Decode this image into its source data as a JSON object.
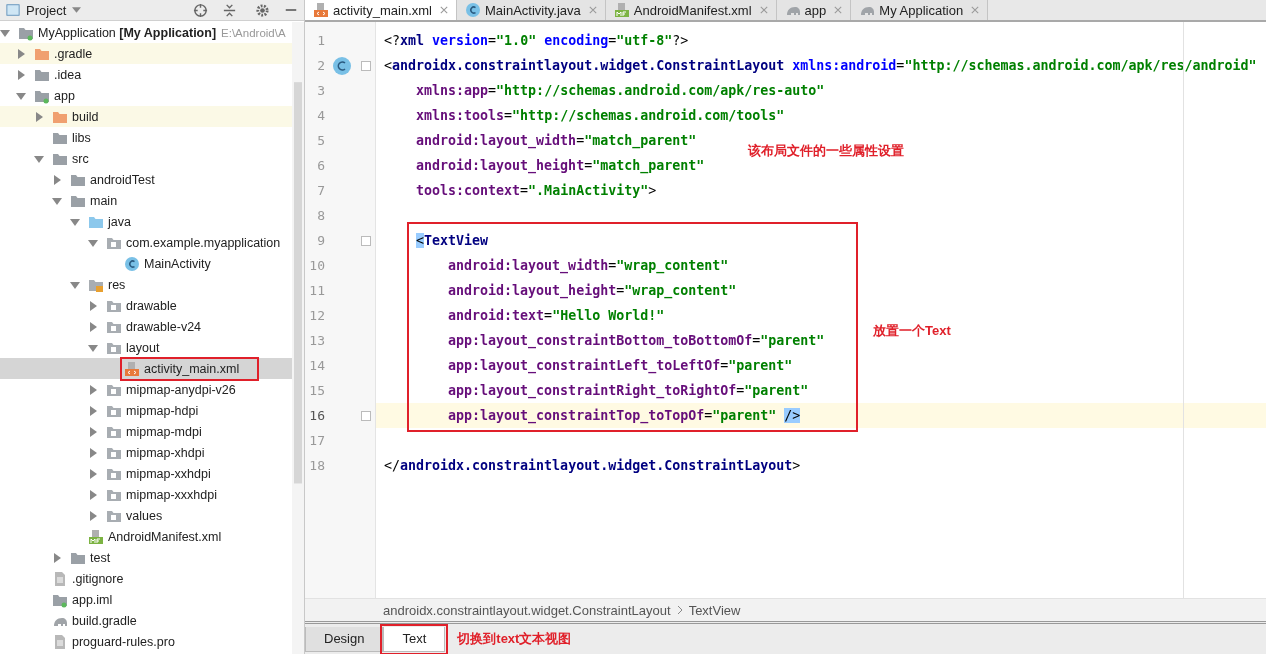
{
  "project_panel": {
    "title": "Project",
    "tree": [
      {
        "label": "MyApplication **[My Application]**",
        "path": "E:\\Android\\A",
        "kind": "module",
        "expanded": true,
        "selected": false,
        "highlighted": false,
        "boxed": false,
        "children": [
          {
            "label": ".gradle",
            "kind": "folder_orange",
            "expanded": false,
            "selected": false,
            "highlighted": true,
            "boxed": false
          },
          {
            "label": ".idea",
            "kind": "folder",
            "expanded": false,
            "selected": false,
            "highlighted": false,
            "boxed": false
          },
          {
            "label": "app",
            "kind": "module",
            "expanded": true,
            "selected": false,
            "highlighted": false,
            "boxed": false,
            "children": [
              {
                "label": "build",
                "kind": "folder_orange",
                "expanded": false,
                "selected": false,
                "highlighted": true,
                "boxed": false
              },
              {
                "label": "libs",
                "kind": "folder",
                "selected": false,
                "highlighted": false,
                "boxed": false
              },
              {
                "label": "src",
                "kind": "folder",
                "expanded": true,
                "selected": false,
                "highlighted": false,
                "boxed": false,
                "children": [
                  {
                    "label": "androidTest",
                    "kind": "folder",
                    "expanded": false,
                    "selected": false,
                    "highlighted": false,
                    "boxed": false
                  },
                  {
                    "label": "main",
                    "kind": "folder",
                    "expanded": true,
                    "selected": false,
                    "highlighted": false,
                    "boxed": false,
                    "children": [
                      {
                        "label": "java",
                        "kind": "folder_blue",
                        "expanded": true,
                        "selected": false,
                        "highlighted": false,
                        "boxed": false,
                        "children": [
                          {
                            "label": "com.example.myapplication",
                            "kind": "package",
                            "expanded": true,
                            "selected": false,
                            "highlighted": false,
                            "boxed": false,
                            "children": [
                              {
                                "label": "MainActivity",
                                "kind": "class",
                                "selected": false,
                                "highlighted": false,
                                "boxed": false
                              }
                            ]
                          }
                        ]
                      },
                      {
                        "label": "res",
                        "kind": "res",
                        "expanded": true,
                        "selected": false,
                        "highlighted": false,
                        "boxed": false,
                        "children": [
                          {
                            "label": "drawable",
                            "kind": "package",
                            "expanded": false,
                            "selected": false,
                            "highlighted": false,
                            "boxed": false
                          },
                          {
                            "label": "drawable-v24",
                            "kind": "package",
                            "expanded": false,
                            "selected": false,
                            "highlighted": false,
                            "boxed": false
                          },
                          {
                            "label": "layout",
                            "kind": "package",
                            "expanded": true,
                            "selected": false,
                            "highlighted": false,
                            "boxed": false,
                            "children": [
                              {
                                "label": "activity_main.xml",
                                "kind": "xml",
                                "selected": true,
                                "highlighted": false,
                                "boxed": true
                              }
                            ]
                          },
                          {
                            "label": "mipmap-anydpi-v26",
                            "kind": "package",
                            "expanded": false,
                            "selected": false,
                            "highlighted": false,
                            "boxed": false
                          },
                          {
                            "label": "mipmap-hdpi",
                            "kind": "package",
                            "expanded": false,
                            "selected": false,
                            "highlighted": false,
                            "boxed": false
                          },
                          {
                            "label": "mipmap-mdpi",
                            "kind": "package",
                            "expanded": false,
                            "selected": false,
                            "highlighted": false,
                            "boxed": false
                          },
                          {
                            "label": "mipmap-xhdpi",
                            "kind": "package",
                            "expanded": false,
                            "selected": false,
                            "highlighted": false,
                            "boxed": false
                          },
                          {
                            "label": "mipmap-xxhdpi",
                            "kind": "package",
                            "expanded": false,
                            "selected": false,
                            "highlighted": false,
                            "boxed": false
                          },
                          {
                            "label": "mipmap-xxxhdpi",
                            "kind": "package",
                            "expanded": false,
                            "selected": false,
                            "highlighted": false,
                            "boxed": false
                          },
                          {
                            "label": "values",
                            "kind": "package",
                            "expanded": false,
                            "selected": false,
                            "highlighted": false,
                            "boxed": false
                          }
                        ]
                      },
                      {
                        "label": "AndroidManifest.xml",
                        "kind": "manifest",
                        "selected": false,
                        "highlighted": false,
                        "boxed": false
                      }
                    ]
                  },
                  {
                    "label": "test",
                    "kind": "folder",
                    "expanded": false,
                    "selected": false,
                    "highlighted": false,
                    "boxed": false
                  }
                ]
              },
              {
                "label": ".gitignore",
                "kind": "file",
                "selected": false,
                "highlighted": false,
                "boxed": false
              },
              {
                "label": "app.iml",
                "kind": "iml",
                "selected": false,
                "highlighted": false,
                "boxed": false
              },
              {
                "label": "build.gradle",
                "kind": "gradle",
                "selected": false,
                "highlighted": false,
                "boxed": false
              },
              {
                "label": "proguard-rules.pro",
                "kind": "file",
                "selected": false,
                "highlighted": false,
                "boxed": false
              }
            ]
          }
        ]
      }
    ]
  },
  "editor_tabs": [
    {
      "label": "activity_main.xml",
      "kind": "xml",
      "selected": true
    },
    {
      "label": "MainActivity.java",
      "kind": "class",
      "selected": false
    },
    {
      "label": "AndroidManifest.xml",
      "kind": "manifest",
      "selected": false
    },
    {
      "label": "app",
      "kind": "gradle",
      "selected": false
    },
    {
      "label": "My Application",
      "kind": "gradle",
      "selected": false
    }
  ],
  "code": [
    {
      "number": "1",
      "kind": "plain",
      "current": false,
      "boxed": false,
      "segments": [
        {
          "kind": "p",
          "text": "<?"
        },
        {
          "kind": "tag",
          "text": "xml"
        },
        {
          "kind": "attr",
          "text": " version"
        },
        {
          "kind": "p",
          "text": "="
        },
        {
          "kind": "value",
          "text": "\"1.0\""
        },
        {
          "kind": "attr",
          "text": " encoding"
        },
        {
          "kind": "p",
          "text": "="
        },
        {
          "kind": "value",
          "text": "\"utf-8\""
        },
        {
          "kind": "p",
          "text": "?>"
        }
      ]
    },
    {
      "number": "2",
      "kind": "root_tag",
      "current": false,
      "boxed": false,
      "segments": [
        {
          "kind": "p",
          "text": "<"
        },
        {
          "kind": "tag",
          "text": "androidx.constraintlayout.widget.ConstraintLayout"
        },
        {
          "kind": "attr",
          "text": " xmlns:android"
        },
        {
          "kind": "p",
          "text": "="
        },
        {
          "kind": "value",
          "text": "\"http://schemas.android.com/apk/res/android\""
        }
      ]
    },
    {
      "number": "3",
      "kind": "plain",
      "current": false,
      "boxed": false,
      "segments": [
        {
          "kind": "ns",
          "text": "    xmlns:app"
        },
        {
          "kind": "p",
          "text": "="
        },
        {
          "kind": "value",
          "text": "\"http://schemas.android.com/apk/res-auto\""
        }
      ]
    },
    {
      "number": "4",
      "kind": "plain",
      "current": false,
      "boxed": false,
      "segments": [
        {
          "kind": "ns",
          "text": "    xmlns:tools"
        },
        {
          "kind": "p",
          "text": "="
        },
        {
          "kind": "value",
          "text": "\"http://schemas.android.com/tools\""
        }
      ]
    },
    {
      "number": "5",
      "kind": "plain",
      "current": false,
      "boxed": false,
      "segments": [
        {
          "kind": "ns",
          "text": "    android:layout_width"
        },
        {
          "kind": "p",
          "text": "="
        },
        {
          "kind": "value",
          "text": "\"match_parent\""
        }
      ]
    },
    {
      "number": "6",
      "kind": "plain",
      "current": false,
      "boxed": false,
      "segments": [
        {
          "kind": "ns",
          "text": "    android:layout_height"
        },
        {
          "kind": "p",
          "text": "="
        },
        {
          "kind": "value",
          "text": "\"match_parent\""
        }
      ]
    },
    {
      "number": "7",
      "kind": "plain",
      "current": false,
      "boxed": false,
      "segments": [
        {
          "kind": "ns",
          "text": "    tools:context"
        },
        {
          "kind": "p",
          "text": "="
        },
        {
          "kind": "value",
          "text": "\".MainActivity\""
        },
        {
          "kind": "p",
          "text": ">"
        }
      ]
    },
    {
      "number": "8",
      "kind": "plain",
      "current": false,
      "boxed": false
    },
    {
      "number": "9",
      "kind": "fold",
      "current": false,
      "boxed": true,
      "segments": [
        {
          "kind": "match",
          "text": "    <"
        },
        {
          "kind": "tag",
          "text": "TextView"
        }
      ]
    },
    {
      "number": "10",
      "kind": "plain",
      "current": false,
      "boxed": true,
      "segments": [
        {
          "kind": "ns",
          "text": "        android:layout_width"
        },
        {
          "kind": "p",
          "text": "="
        },
        {
          "kind": "value",
          "text": "\"wrap_content\""
        }
      ]
    },
    {
      "number": "11",
      "kind": "plain",
      "current": false,
      "boxed": true,
      "segments": [
        {
          "kind": "ns",
          "text": "        android:layout_height"
        },
        {
          "kind": "p",
          "text": "="
        },
        {
          "kind": "value",
          "text": "\"wrap_content\""
        }
      ]
    },
    {
      "number": "12",
      "kind": "plain",
      "current": false,
      "boxed": true,
      "segments": [
        {
          "kind": "ns",
          "text": "        android:text"
        },
        {
          "kind": "p",
          "text": "="
        },
        {
          "kind": "value",
          "text": "\"Hello World!\""
        }
      ]
    },
    {
      "number": "13",
      "kind": "plain",
      "current": false,
      "boxed": true,
      "segments": [
        {
          "kind": "ns",
          "text": "        app:layout_constraintBottom_toBottomOf"
        },
        {
          "kind": "p",
          "text": "="
        },
        {
          "kind": "value",
          "text": "\"parent\""
        }
      ]
    },
    {
      "number": "14",
      "kind": "plain",
      "current": false,
      "boxed": true,
      "segments": [
        {
          "kind": "ns",
          "text": "        app:layout_constraintLeft_toLeftOf"
        },
        {
          "kind": "p",
          "text": "="
        },
        {
          "kind": "value",
          "text": "\"parent\""
        }
      ]
    },
    {
      "number": "15",
      "kind": "plain",
      "current": false,
      "boxed": true,
      "segments": [
        {
          "kind": "ns",
          "text": "        app:layout_constraintRight_toRightOf"
        },
        {
          "kind": "p",
          "text": "="
        },
        {
          "kind": "value",
          "text": "\"parent\""
        }
      ]
    },
    {
      "number": "16",
      "kind": "fold",
      "current": true,
      "boxed": true,
      "segments": [
        {
          "kind": "ns",
          "text": "        app:layout_constraintTop_toTopOf"
        },
        {
          "kind": "p",
          "text": "="
        },
        {
          "kind": "value",
          "text": "\"parent\" "
        },
        {
          "kind": "match",
          "text": "/>"
        }
      ]
    },
    {
      "number": "17",
      "kind": "plain",
      "current": false,
      "boxed": false
    },
    {
      "number": "18",
      "kind": "plain",
      "current": false,
      "boxed": false,
      "segments": [
        {
          "kind": "p",
          "text": "</"
        },
        {
          "kind": "tag",
          "text": "androidx.constraintlayout.widget.ConstraintLayout"
        },
        {
          "kind": "p",
          "text": ">"
        }
      ]
    }
  ],
  "annotations": [
    "该布局文件的一些属性设置",
    "放置一个Text"
  ],
  "breadcrumb": [
    "androidx.constraintlayout.widget.ConstraintLayout",
    "TextView"
  ],
  "bottom_tabs": [
    {
      "label": "Design",
      "selected": false,
      "boxed": false
    },
    {
      "label": "Text",
      "selected": true,
      "boxed": true
    }
  ],
  "bottom_annotation": "切换到text文本视图"
}
